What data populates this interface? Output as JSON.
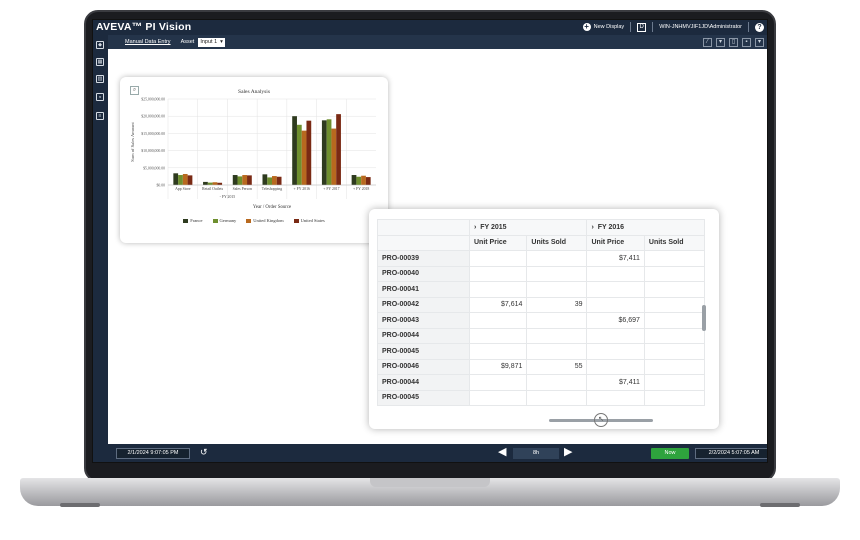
{
  "app": {
    "brand": "AVEVA™ PI Vision",
    "brand_tm": "™",
    "new_display_label": "New Display",
    "user": "WIN-JNHMVJIF1JD\\Administrator",
    "help": "?",
    "toolbar_box": "D"
  },
  "toolbar": {
    "manual_data_entry": "Manual Data Entry",
    "asset_label": "Asset",
    "asset_value": "Input 1",
    "asset_chevron": "▾"
  },
  "nav_icons": [
    "cube-icon",
    "grid-icon",
    "library-icon",
    "coffee-cup-icon",
    "database-icon"
  ],
  "timebar": {
    "start_time": "2/1/2024 9:07:05 PM",
    "duration": "8h",
    "now_label": "Now",
    "end_time": "2/2/2024 5:07:05 AM"
  },
  "chart_data": {
    "type": "bar",
    "title": "Sales Analysis",
    "xlabel": "Year / Order Source",
    "ylabel": "Sum of Sales Amount",
    "yticks": [
      "$25,000,000.00",
      "$20,000,000.00",
      "$15,000,000.00",
      "$10,000,000.00",
      "$5,000,000.00",
      "$0.00"
    ],
    "ylim": [
      0,
      25000000
    ],
    "categories": [
      "App Store",
      "Retail Outlets",
      "Sales Person",
      "Teleshopping",
      "+ FY 2016",
      "+ FY 2017",
      "+ FY 2018"
    ],
    "group_label": "- FY 2015",
    "series": [
      {
        "name": "France",
        "color": "#2e3b1f",
        "values": [
          3400000,
          900000,
          2900000,
          3100000,
          20000000,
          18800000,
          2900000
        ]
      },
      {
        "name": "Germany",
        "color": "#6e8f2e",
        "values": [
          2900000,
          700000,
          2500000,
          2200000,
          17500000,
          19100000,
          2400000
        ]
      },
      {
        "name": "United Kingdom",
        "color": "#b8691f",
        "values": [
          3200000,
          800000,
          2900000,
          2600000,
          15800000,
          16400000,
          2700000
        ]
      },
      {
        "name": "United States",
        "color": "#7a2a14",
        "values": [
          2800000,
          650000,
          2800000,
          2400000,
          18700000,
          20600000,
          2300000
        ]
      }
    ],
    "grid": true,
    "legend_position": "bottom"
  },
  "table": {
    "group_headers": [
      "FY 2015",
      "FY 2016"
    ],
    "group_chevron": "›",
    "columns": [
      "Unit Price",
      "Units Sold",
      "Unit Price",
      "Units Sold"
    ],
    "rows": [
      {
        "id": "PRO-00039",
        "cells": [
          "",
          "",
          "$7,411",
          ""
        ]
      },
      {
        "id": "PRO-00040",
        "cells": [
          "",
          "",
          "",
          ""
        ]
      },
      {
        "id": "PRO-00041",
        "cells": [
          "",
          "",
          "",
          ""
        ]
      },
      {
        "id": "PRO-00042",
        "cells": [
          "$7,614",
          "39",
          "",
          ""
        ]
      },
      {
        "id": "PRO-00043",
        "cells": [
          "",
          "",
          "$6,697",
          ""
        ]
      },
      {
        "id": "PRO-00044",
        "cells": [
          "",
          "",
          "",
          ""
        ]
      },
      {
        "id": "PRO-00045",
        "cells": [
          "",
          "",
          "",
          ""
        ]
      },
      {
        "id": "PRO-00046",
        "cells": [
          "$9,871",
          "55",
          "",
          ""
        ]
      },
      {
        "id": "PRO-00044",
        "cells": [
          "",
          "",
          "$7,411",
          ""
        ]
      },
      {
        "id": "PRO-00045",
        "cells": [
          "",
          "",
          "",
          ""
        ]
      }
    ]
  }
}
